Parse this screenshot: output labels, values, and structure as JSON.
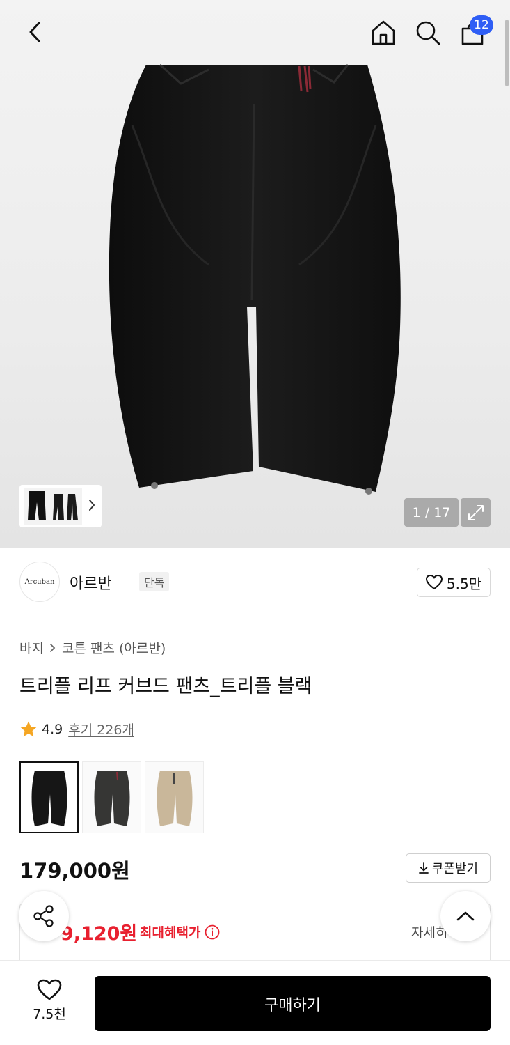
{
  "header": {
    "bag_count": "12"
  },
  "gallery": {
    "counter": "1 / 17"
  },
  "brand": {
    "logo_text": "Arcuban",
    "name": "아르반",
    "exclusive_badge": "단독",
    "likes": "5.5만"
  },
  "breadcrumb": {
    "category": "바지",
    "subcategory": "코튼 팬츠 (아르반)"
  },
  "product": {
    "title": "트리플 리프 커브드 팬츠_트리플 블랙",
    "rating": "4.9",
    "review_link": "후기 226개",
    "price": "179,000원",
    "coupon_label": "쿠폰받기"
  },
  "benefit": {
    "price": "9,120원",
    "label": "최대혜택가",
    "detail": "자세히"
  },
  "swatches": [
    {
      "color": "#1a1a1a",
      "selected": true
    },
    {
      "color": "#3a3a38",
      "selected": false
    },
    {
      "color": "#c9b79a",
      "selected": false
    }
  ],
  "bottom_bar": {
    "wish_count": "7.5천",
    "buy_label": "구매하기"
  },
  "colors": {
    "accent_red": "#e8202f",
    "badge_blue": "#2f5ef5",
    "buy_button": "#000000"
  }
}
